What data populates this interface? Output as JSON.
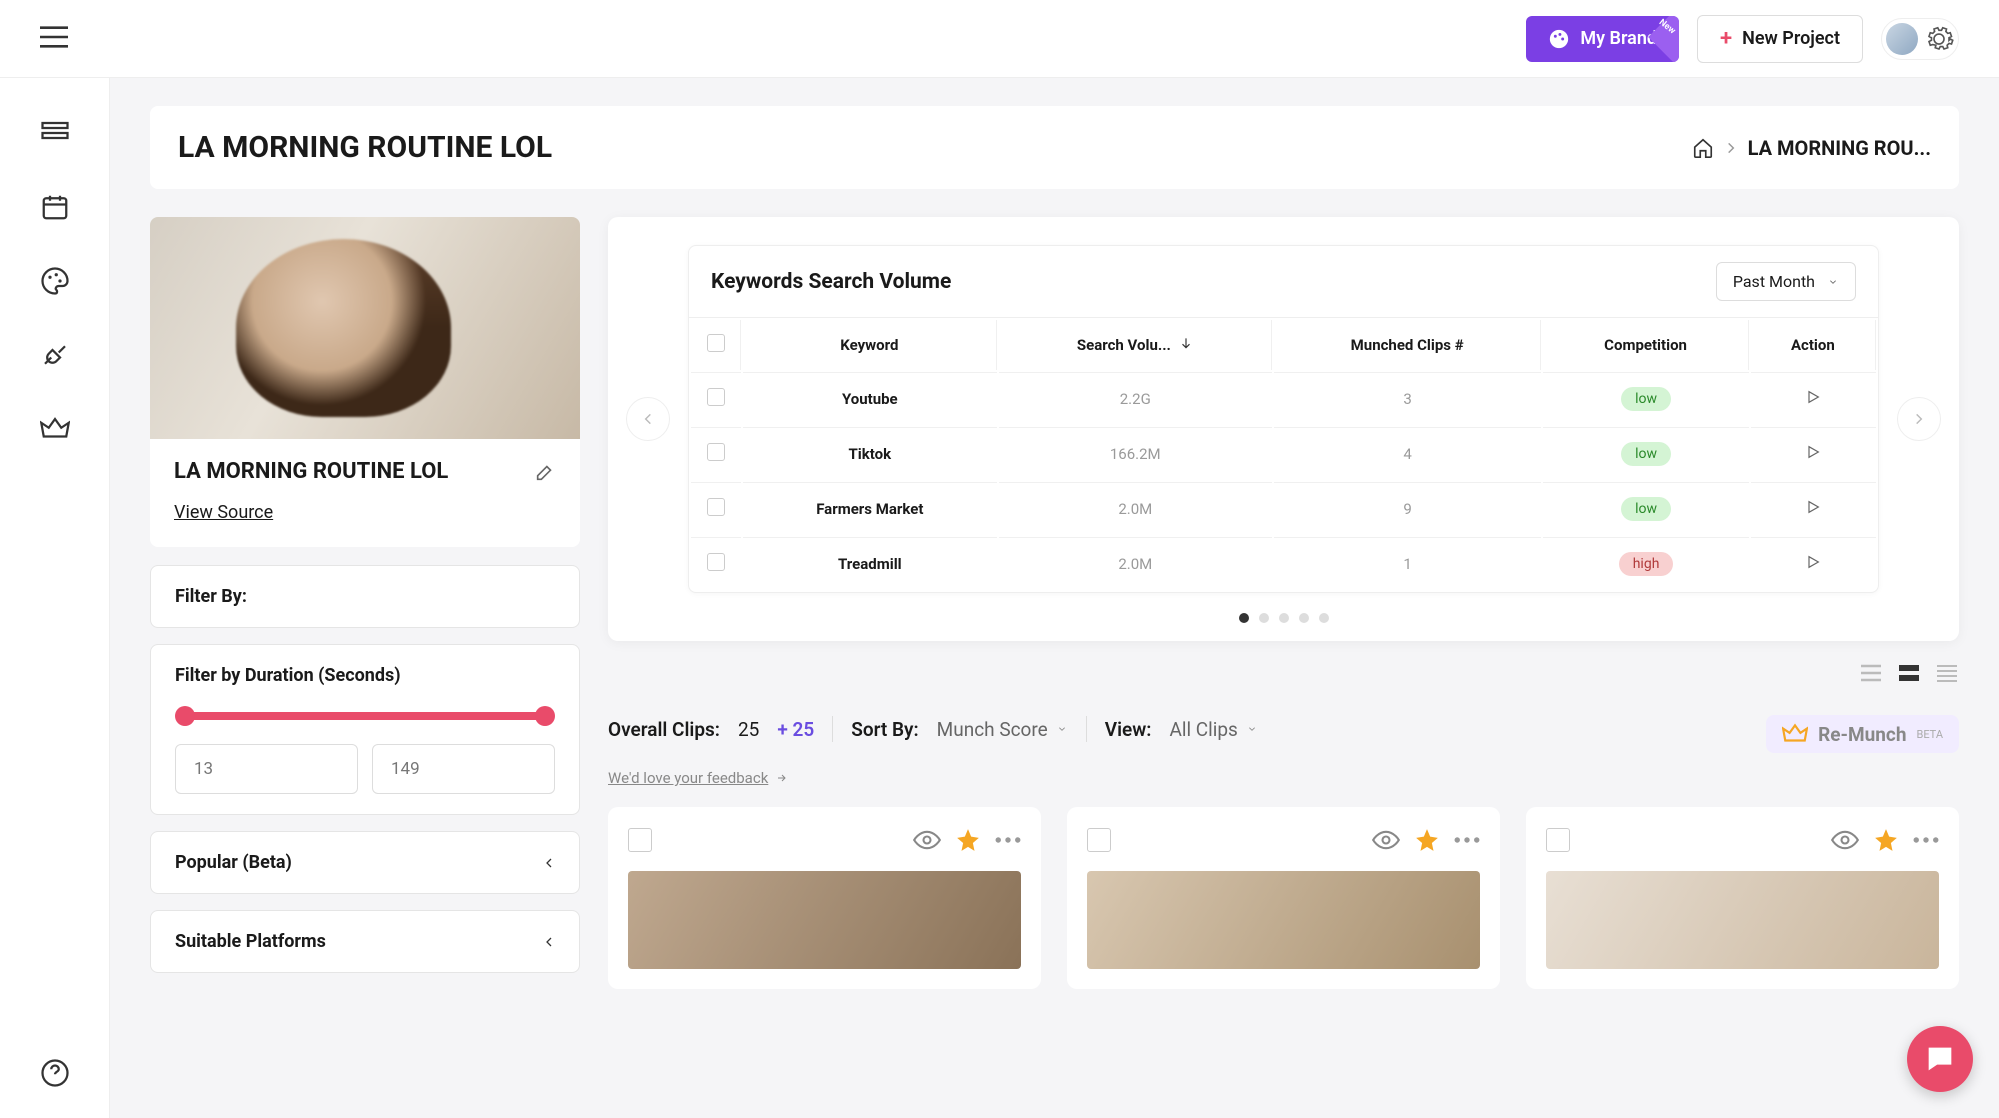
{
  "header": {
    "brand_button": "My Brand",
    "brand_badge": "New",
    "new_project": "New Project"
  },
  "page": {
    "title": "LA MORNING ROUTINE LOL",
    "breadcrumb": "LA MORNING ROU..."
  },
  "project_card": {
    "title": "LA MORNING ROUTINE LOL",
    "view_source": "View Source"
  },
  "filters": {
    "by_label": "Filter By:",
    "duration_label": "Filter by Duration (Seconds)",
    "duration_min": "13",
    "duration_max": "149",
    "popular": "Popular (Beta)",
    "suitable": "Suitable Platforms"
  },
  "keywords": {
    "heading": "Keywords Search Volume",
    "period": "Past Month",
    "columns": {
      "keyword": "Keyword",
      "search_vol": "Search Volu...",
      "munched": "Munched Clips #",
      "competition": "Competition",
      "action": "Action"
    },
    "rows": [
      {
        "keyword": "Youtube",
        "volume": "2.2G",
        "munched": "3",
        "competition": "low"
      },
      {
        "keyword": "Tiktok",
        "volume": "166.2M",
        "munched": "4",
        "competition": "low"
      },
      {
        "keyword": "Farmers Market",
        "volume": "2.0M",
        "munched": "9",
        "competition": "low"
      },
      {
        "keyword": "Treadmill",
        "volume": "2.0M",
        "munched": "1",
        "competition": "high"
      }
    ]
  },
  "clips": {
    "overall_label": "Overall Clips:",
    "overall_count": "25",
    "plus_count": "+ 25",
    "sort_by_label": "Sort By:",
    "sort_by_value": "Munch Score",
    "view_label": "View:",
    "view_value": "All Clips",
    "remunch": "Re-Munch",
    "remunch_beta": "BETA",
    "feedback": "We'd love your feedback"
  },
  "colors": {
    "accent": "#e94b6a",
    "purple": "#7b3fe4"
  }
}
